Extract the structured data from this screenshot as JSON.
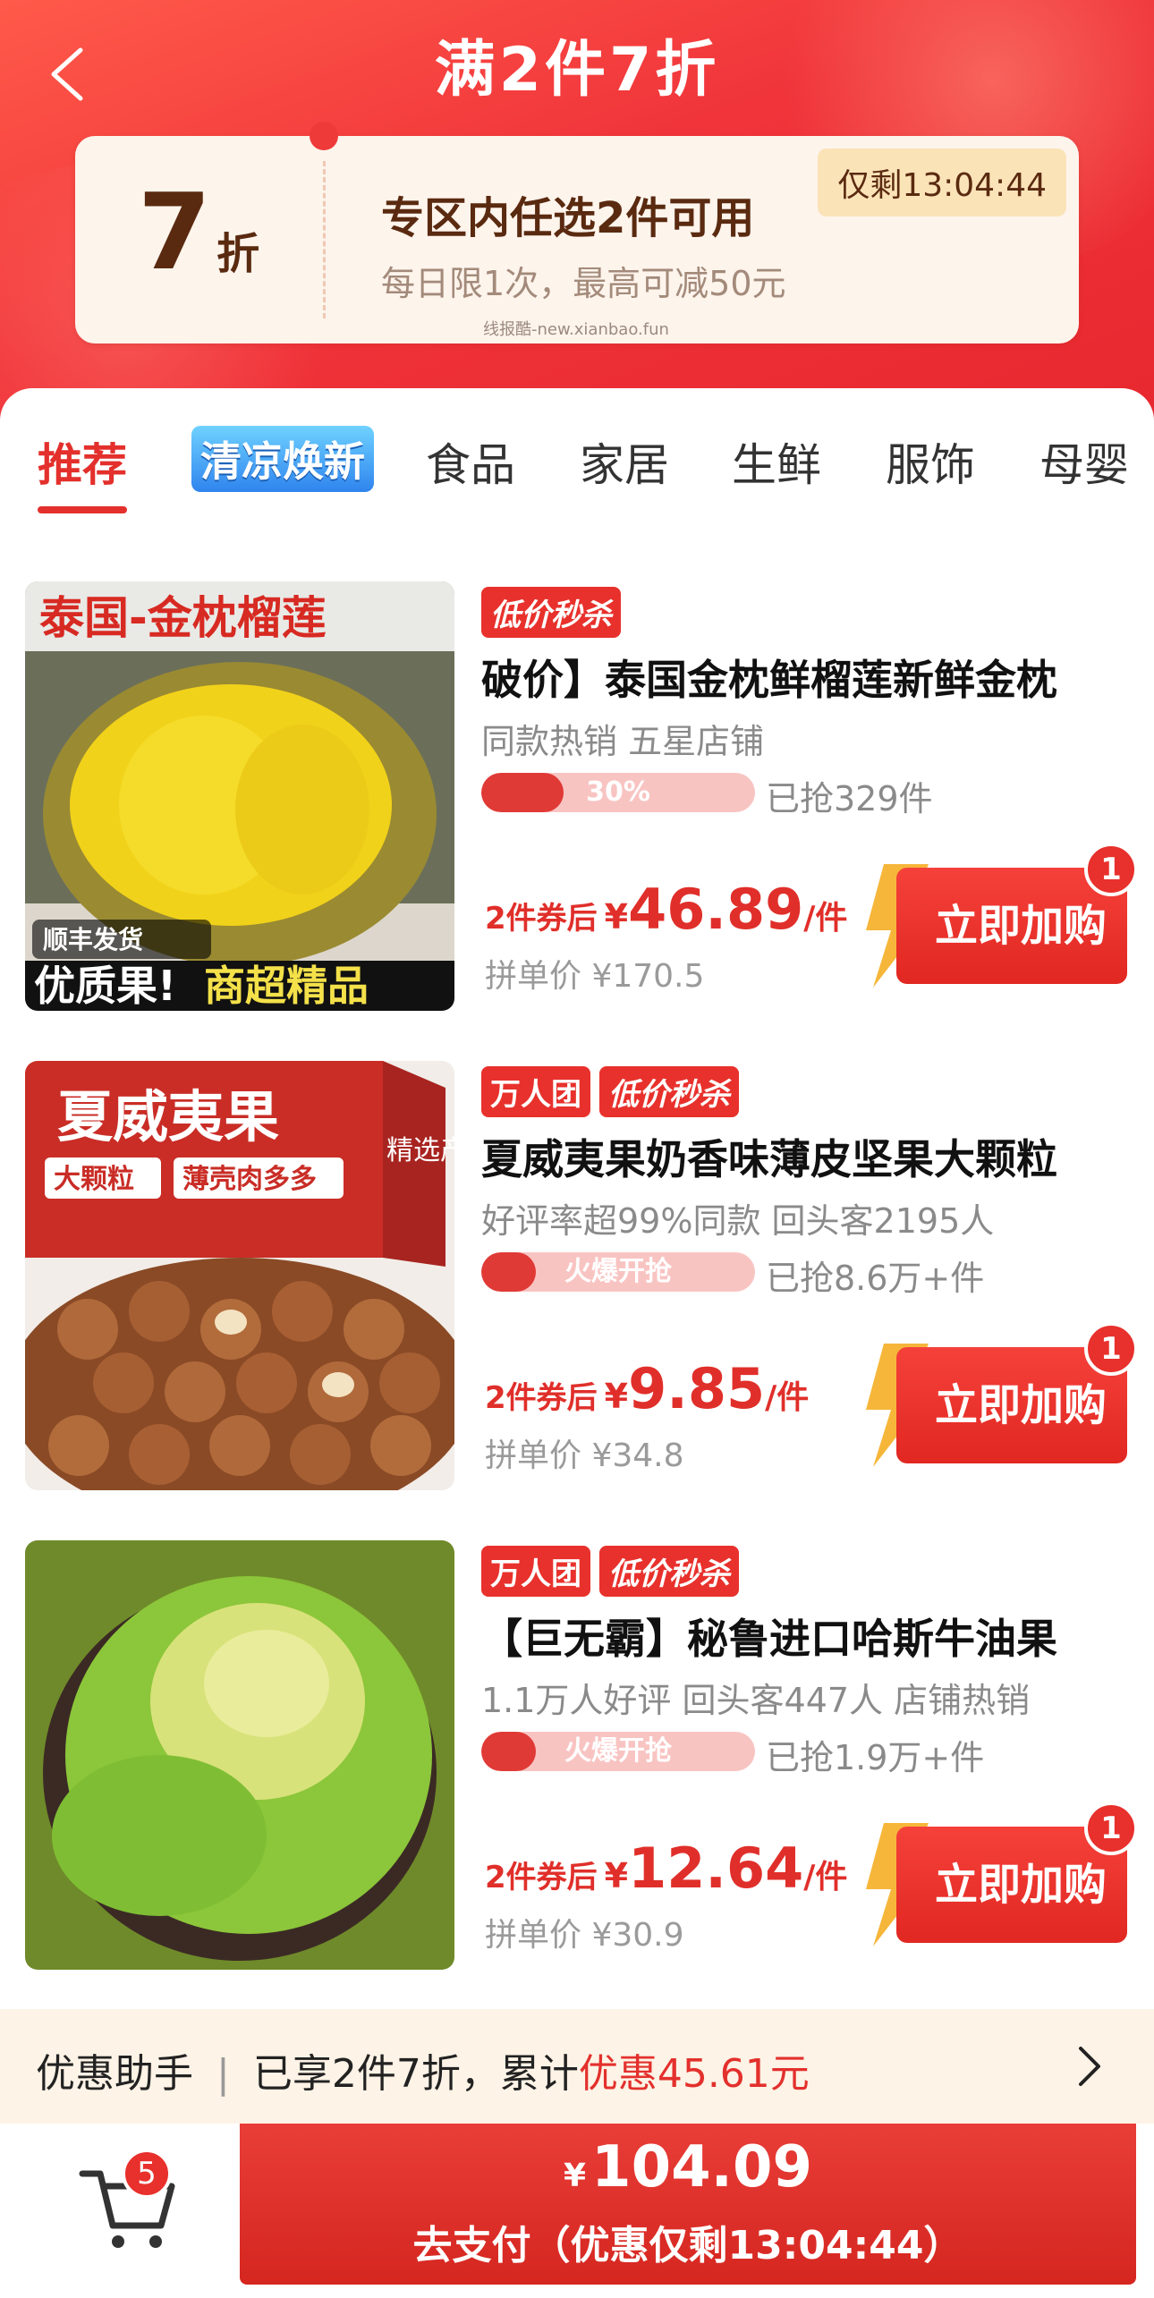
{
  "header": {
    "title": "满2件7折",
    "coupon": {
      "discount_num": "7",
      "discount_unit": "折",
      "title": "专区内任选2件可用",
      "subtitle": "每日限1次，最高可减50元",
      "timer": "仅剩13:04:44"
    },
    "watermark": "线报酷-new.xianbao.fun"
  },
  "tabs": [
    {
      "label": "推荐",
      "active": true
    },
    {
      "label": "清凉焕新",
      "active": false
    },
    {
      "label": "食品",
      "active": false
    },
    {
      "label": "家居",
      "active": false
    },
    {
      "label": "生鲜",
      "active": false
    },
    {
      "label": "服饰",
      "active": false
    },
    {
      "label": "母婴",
      "active": false
    }
  ],
  "products": [
    {
      "badges": [
        "低价秒杀"
      ],
      "title": "破价】泰国金枕鲜榴莲新鲜金枕",
      "tags": "同款热销  五星店铺",
      "progress_text": "30%",
      "progress": 0.3,
      "sold": "已抢329件",
      "price_prefix": "2件券后",
      "currency": "¥",
      "price": "46.89",
      "price_unit": "/件",
      "original_price": "拼单价 ¥170.5",
      "buy_label": "立即加购",
      "cart_qty": "1",
      "image": {
        "banner": "泰国-金枕榴莲",
        "ship": "顺丰发货",
        "bottom_a": "优质果!",
        "bottom_b": "商超精品"
      }
    },
    {
      "badges": [
        "万人团",
        "低价秒杀"
      ],
      "title": "夏威夷果奶香味薄皮坚果大颗粒",
      "tags": "好评率超99%同款  回头客2195人",
      "progress_text": "火爆开抢",
      "progress": 0.2,
      "sold": "已抢8.6万+件",
      "price_prefix": "2件券后",
      "currency": "¥",
      "price": "9.85",
      "price_unit": "/件",
      "original_price": "拼单价 ¥34.8",
      "buy_label": "立即加购",
      "cart_qty": "1",
      "image": {
        "box_title": "夏威夷果",
        "tag_a": "大颗粒",
        "tag_b": "薄壳肉多多",
        "side": "精选产地"
      }
    },
    {
      "badges": [
        "万人团",
        "低价秒杀"
      ],
      "title": "【巨无霸】秘鲁进口哈斯牛油果",
      "tags": "1.1万人好评  回头客447人  店铺热销",
      "progress_text": "火爆开抢",
      "progress": 0.2,
      "sold": "已抢1.9万+件",
      "price_prefix": "2件券后",
      "currency": "¥",
      "price": "12.64",
      "price_unit": "/件",
      "original_price": "拼单价 ¥30.9",
      "buy_label": "立即加购",
      "cart_qty": "1"
    }
  ],
  "helper": {
    "label": "优惠助手",
    "text": "已享2件7折，累计",
    "highlight": "优惠45.61元"
  },
  "checkout": {
    "cart_count": "5",
    "currency": "¥",
    "total": "104.09",
    "label": "去支付（优惠仅剩13:04:44）"
  },
  "colors": {
    "brand_red": "#e3302c",
    "coupon_bg": "#fdf4ec",
    "helper_bg": "#fdf3e6",
    "tab_special_blue": "#2f84ee"
  }
}
